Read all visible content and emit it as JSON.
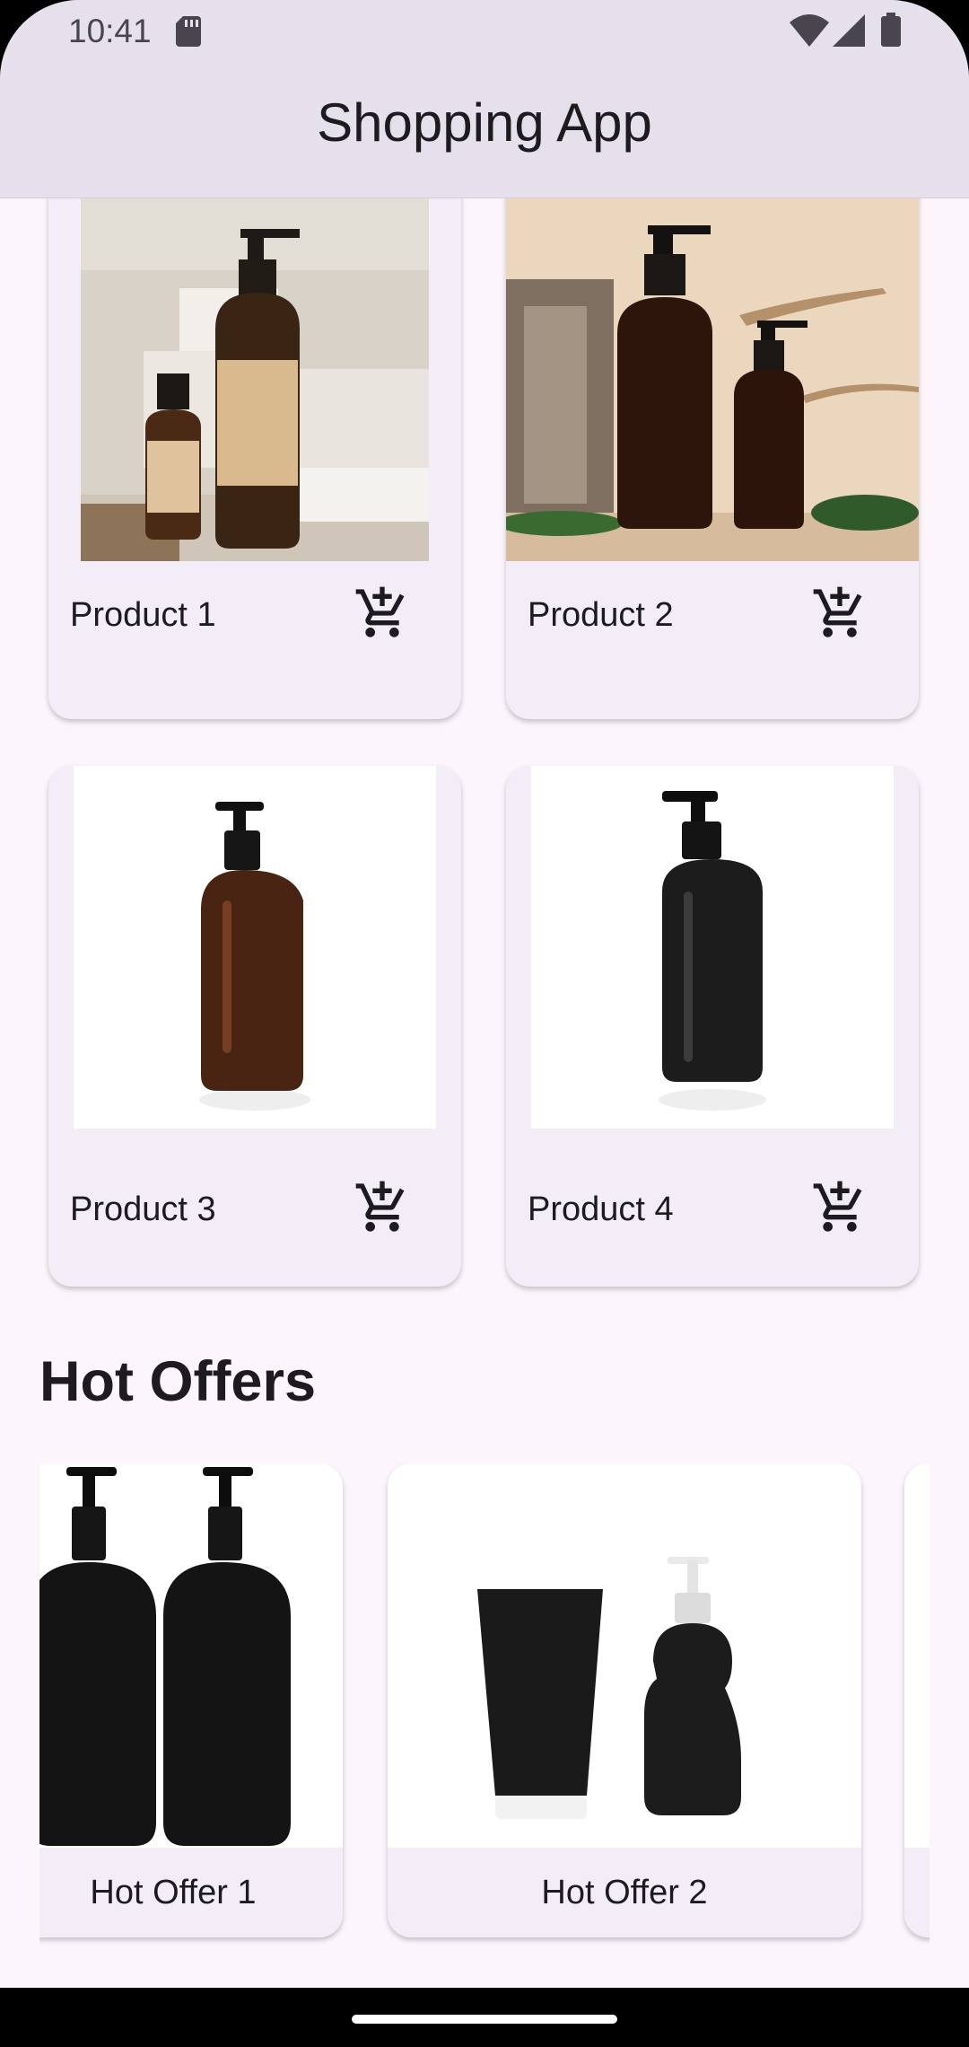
{
  "status_bar": {
    "time": "10:41",
    "icons": [
      "sd-card-icon",
      "wifi-icon",
      "signal-icon",
      "battery-icon"
    ]
  },
  "app_bar": {
    "title": "Shopping App"
  },
  "products": [
    {
      "name": "Product 1",
      "action_icon": "add-shopping-cart-icon"
    },
    {
      "name": "Product 2",
      "action_icon": "add-shopping-cart-icon"
    },
    {
      "name": "Product 3",
      "action_icon": "add-shopping-cart-icon"
    },
    {
      "name": "Product 4",
      "action_icon": "add-shopping-cart-icon"
    }
  ],
  "hot_offers": {
    "title": "Hot Offers",
    "items": [
      {
        "label": "Hot Offer 1"
      },
      {
        "label": "Hot Offer 2"
      }
    ]
  },
  "colors": {
    "background": "#fcf5fc",
    "app_bar": "#e6e0ec",
    "card": "#f3edf7",
    "text": "#1d1b20"
  }
}
